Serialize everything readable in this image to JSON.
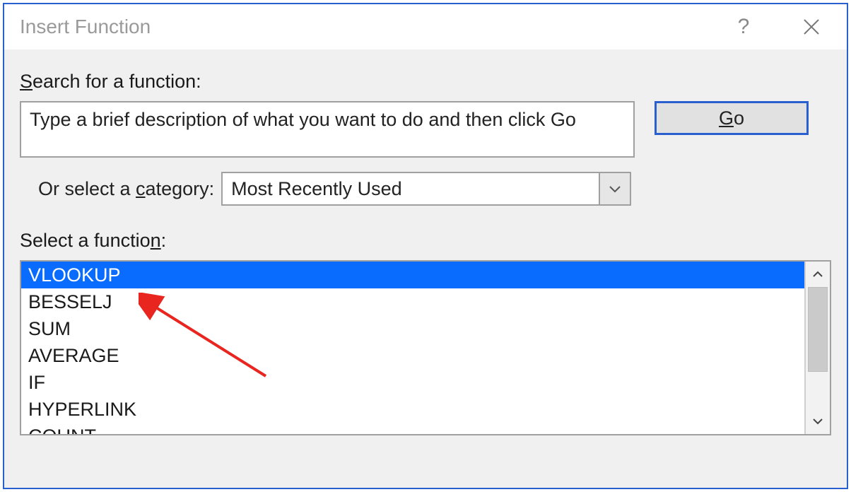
{
  "title": "Insert Function",
  "search": {
    "label_pre": "S",
    "label_post": "earch for a function:",
    "value": "Type a brief description of what you want to do and then click Go"
  },
  "go_button": {
    "pre": "G",
    "post": "o"
  },
  "category": {
    "label_pre": "Or select a ",
    "label_ul": "c",
    "label_post": "ategory:",
    "selected": "Most Recently Used"
  },
  "select_function": {
    "label_pre": "Select a functio",
    "label_ul": "n",
    "label_post": ":"
  },
  "functions": [
    "VLOOKUP",
    "BESSELJ",
    "SUM",
    "AVERAGE",
    "IF",
    "HYPERLINK",
    "COUNT"
  ],
  "selected_index": 0
}
